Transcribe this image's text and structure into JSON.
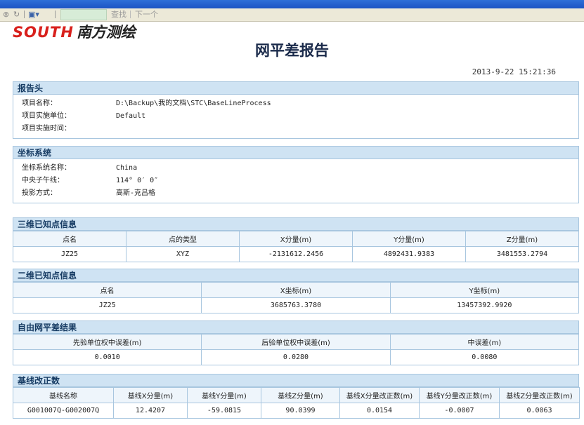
{
  "toolbar": {
    "search_label": "查找",
    "next_label": "下一个"
  },
  "logo": {
    "south": "SOUTH",
    "cn": "南方测绘"
  },
  "report": {
    "title": "网平差报告",
    "date": "2013-9-22 15:21:36"
  },
  "header_section": {
    "title": "报告头",
    "rows": [
      {
        "label": "项目名称：",
        "value": "D:\\Backup\\我的文档\\STC\\BaseLineProcess"
      },
      {
        "label": "项目实施单位：",
        "value": "Default"
      },
      {
        "label": "项目实施时间：",
        "value": ""
      }
    ]
  },
  "coord_section": {
    "title": "坐标系统",
    "rows": [
      {
        "label": "坐标系统名称：",
        "value": "China"
      },
      {
        "label": "中央子午线：",
        "value": "114° 0′ 0″"
      },
      {
        "label": "投影方式：",
        "value": "高斯-克吕格"
      }
    ]
  },
  "known3d": {
    "title": "三维已知点信息",
    "headers": [
      "点名",
      "点的类型",
      "X分量(m)",
      "Y分量(m)",
      "Z分量(m)"
    ],
    "row": [
      "JZ25",
      "XYZ",
      "-2131612.2456",
      "4892431.9383",
      "3481553.2794"
    ]
  },
  "known2d": {
    "title": "二维已知点信息",
    "headers": [
      "点名",
      "X坐标(m)",
      "Y坐标(m)"
    ],
    "row": [
      "JZ25",
      "3685763.3780",
      "13457392.9920"
    ]
  },
  "free": {
    "title": "自由网平差结果",
    "headers": [
      "先验单位权中误差(m)",
      "后验单位权中误差(m)",
      "中误差(m)"
    ],
    "row": [
      "0.0010",
      "0.0280",
      "0.0080"
    ]
  },
  "baseline": {
    "title": "基线改正数",
    "headers": [
      "基线名称",
      "基线X分量(m)",
      "基线Y分量(m)",
      "基线Z分量(m)",
      "基线X分量改正数(m)",
      "基线Y分量改正数(m)",
      "基线Z分量改正数(m)"
    ],
    "row": [
      "G001007Q-G002007Q",
      "12.4207",
      "-59.0815",
      "90.0399",
      "0.0154",
      "-0.0007",
      "0.0063"
    ]
  }
}
